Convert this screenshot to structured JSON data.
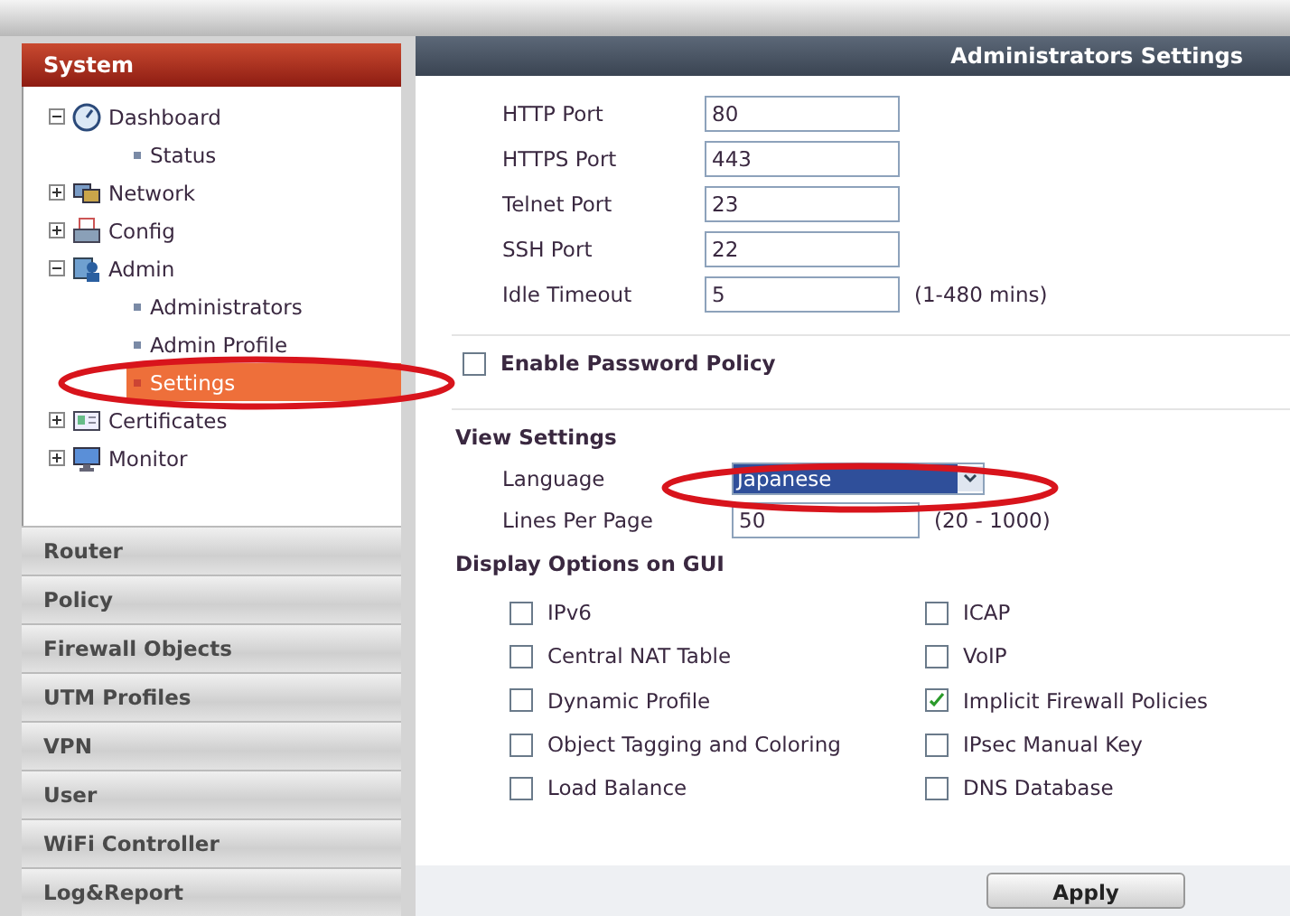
{
  "sidebar": {
    "header": "System",
    "tree": [
      {
        "label": "Dashboard",
        "kind": "dashboard",
        "expanded": true,
        "children": [
          {
            "label": "Status",
            "selected": false
          }
        ]
      },
      {
        "label": "Network",
        "kind": "network",
        "expanded": false
      },
      {
        "label": "Config",
        "kind": "config",
        "expanded": false
      },
      {
        "label": "Admin",
        "kind": "admin",
        "expanded": true,
        "children": [
          {
            "label": "Administrators",
            "selected": false
          },
          {
            "label": "Admin Profile",
            "selected": false
          },
          {
            "label": "Settings",
            "selected": true
          }
        ]
      },
      {
        "label": "Certificates",
        "kind": "certificates",
        "expanded": false
      },
      {
        "label": "Monitor",
        "kind": "monitor",
        "expanded": false
      }
    ],
    "sections": [
      "Router",
      "Policy",
      "Firewall Objects",
      "UTM Profiles",
      "VPN",
      "User",
      "WiFi Controller",
      "Log&Report"
    ]
  },
  "panel": {
    "title": "Administrators Settings",
    "ports": [
      {
        "label": "HTTP Port",
        "value": "80"
      },
      {
        "label": "HTTPS Port",
        "value": "443"
      },
      {
        "label": "Telnet Port",
        "value": "23"
      },
      {
        "label": "SSH Port",
        "value": "22"
      },
      {
        "label": "Idle Timeout",
        "value": "5",
        "hint": "(1-480 mins)"
      }
    ],
    "password_policy": {
      "label": "Enable Password Policy",
      "checked": false
    },
    "view_settings": {
      "title": "View Settings",
      "language": {
        "label": "Language",
        "value": "Japanese"
      },
      "lines_per_page": {
        "label": "Lines Per Page",
        "value": "50",
        "hint": "(20 - 1000)"
      }
    },
    "display_options": {
      "title": "Display Options on GUI",
      "options": [
        {
          "label": "IPv6",
          "checked": false
        },
        {
          "label": "ICAP",
          "checked": false
        },
        {
          "label": "Central NAT Table",
          "checked": false
        },
        {
          "label": "VoIP",
          "checked": false
        },
        {
          "label": "Dynamic Profile",
          "checked": false
        },
        {
          "label": "Implicit Firewall Policies",
          "checked": true
        },
        {
          "label": "Object Tagging and Coloring",
          "checked": false
        },
        {
          "label": "IPsec Manual Key",
          "checked": false
        },
        {
          "label": "Load Balance",
          "checked": false
        },
        {
          "label": "DNS Database",
          "checked": false
        }
      ]
    },
    "apply": "Apply"
  },
  "annotations": [
    {
      "kind": "ellipse"
    },
    {
      "kind": "ellipse"
    }
  ]
}
